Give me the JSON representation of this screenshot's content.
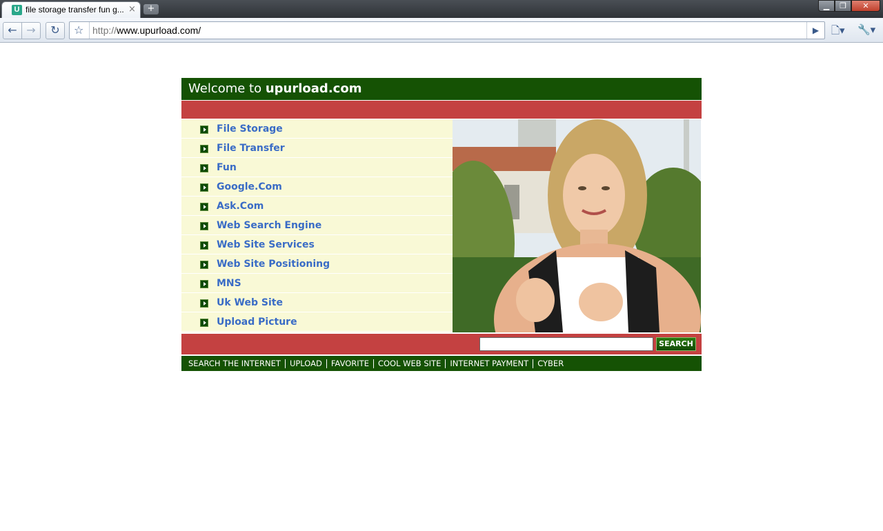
{
  "browser": {
    "tab_title": "file storage transfer fun g...",
    "tab_favicon": "U",
    "tab_close": "×",
    "new_tab": "+",
    "url_scheme": "http://",
    "url_host": "www.upurload.com/",
    "icons": [
      "back-arrow-icon",
      "forward-arrow-icon",
      "reload-icon",
      "star-icon",
      "go-icon",
      "page-icon",
      "wrench-icon"
    ]
  },
  "site": {
    "welcome": "Welcome to ",
    "brand": "upurload.com",
    "menu": [
      "File Storage",
      "File Transfer",
      "Fun",
      "Google.Com",
      "Ask.Com",
      "Web Search Engine",
      "Web Site Services",
      "Web Site Positioning",
      "MNS",
      "Uk Web Site",
      "Upload Picture"
    ],
    "search_button": "SEARCH",
    "search_value": "",
    "footer_links": [
      "SEARCH THE INTERNET",
      "UPLOAD",
      "FAVORITE",
      "COOL WEB SITE",
      "INTERNET PAYMENT",
      "CYBER"
    ]
  },
  "colors": {
    "header_green": "#155204",
    "accent_red": "#c44141",
    "menu_bg": "#f9f9d6",
    "link_blue": "#3a6cc6"
  }
}
